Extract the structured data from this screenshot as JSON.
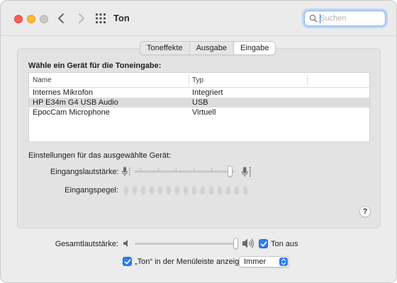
{
  "window": {
    "title": "Ton"
  },
  "search": {
    "placeholder": "Suchen",
    "value": ""
  },
  "tabs": [
    {
      "label": "Toneffekte",
      "active": false
    },
    {
      "label": "Ausgabe",
      "active": false
    },
    {
      "label": "Eingabe",
      "active": true
    }
  ],
  "device_section": {
    "heading": "Wähle ein Gerät für die Toneingabe:",
    "columns": [
      "Name",
      "Typ"
    ],
    "rows": [
      {
        "name": "Internes Mikrofon",
        "type": "Integriert",
        "selected": false
      },
      {
        "name": "HP E34m G4 USB Audio",
        "type": "USB",
        "selected": true
      },
      {
        "name": "EpocCam Microphone",
        "type": "Virtuell",
        "selected": false
      }
    ]
  },
  "selected_device_settings": {
    "label": "Einstellungen für das ausgewählte Gerät:",
    "input_volume_label": "Eingangslautstärke:",
    "input_volume_value": 0.98,
    "input_level_label": "Eingangspegel:",
    "input_level_active_segments": 0,
    "input_level_total_segments": 15
  },
  "help": {
    "label": "?"
  },
  "output": {
    "volume_label": "Gesamtlautstärke:",
    "volume_value": 1.0,
    "mute_label": "Ton aus",
    "mute_checked": true
  },
  "menubar": {
    "show_label": "„Ton“ in der Menüleiste anzeigen",
    "show_checked": true,
    "option_selected": "Immer"
  },
  "colors": {
    "accent": "#2e7cf6",
    "close": "#fe5f57",
    "minimize": "#febc2e",
    "maximize_inactive": "#c9c9c9"
  },
  "icons": {
    "back": "chevron-left-icon",
    "forward": "chevron-right-icon",
    "show_all": "grid-icon",
    "search": "magnifier-icon",
    "mic_low": "microphone-low-icon",
    "mic_high": "microphone-high-icon",
    "speaker_low": "speaker-low-icon",
    "speaker_high": "speaker-high-icon"
  }
}
